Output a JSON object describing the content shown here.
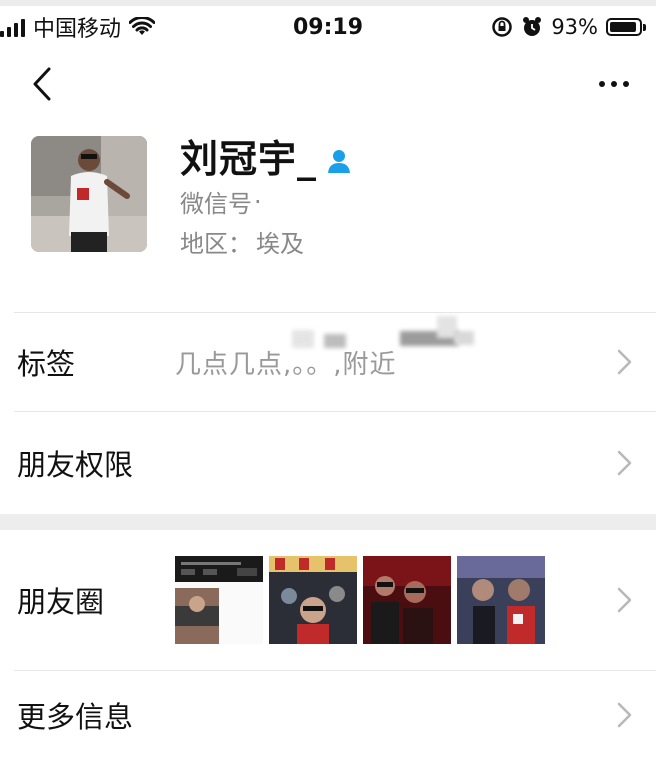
{
  "status_bar": {
    "carrier": "中国移动",
    "time": "09:19",
    "battery": "93%",
    "battery_level": 0.93
  },
  "nav": {
    "back_icon": "chevron-left-icon",
    "more_icon": "ellipsis-icon"
  },
  "profile": {
    "name": "刘冠宇_",
    "wechat_id_label": "微信号",
    "region_label": "地区：",
    "region_value": "埃及"
  },
  "rows": {
    "tags_label": "标签",
    "tags_value": "几点几点,。。,附近",
    "permissions_label": "朋友权限",
    "moments_label": "朋友圈",
    "more_info_label": "更多信息"
  },
  "colors": {
    "text": "#111111",
    "secondary": "#888888",
    "divider": "#e6e6e6",
    "accent": "#1aa0e8",
    "band": "#ededed"
  }
}
